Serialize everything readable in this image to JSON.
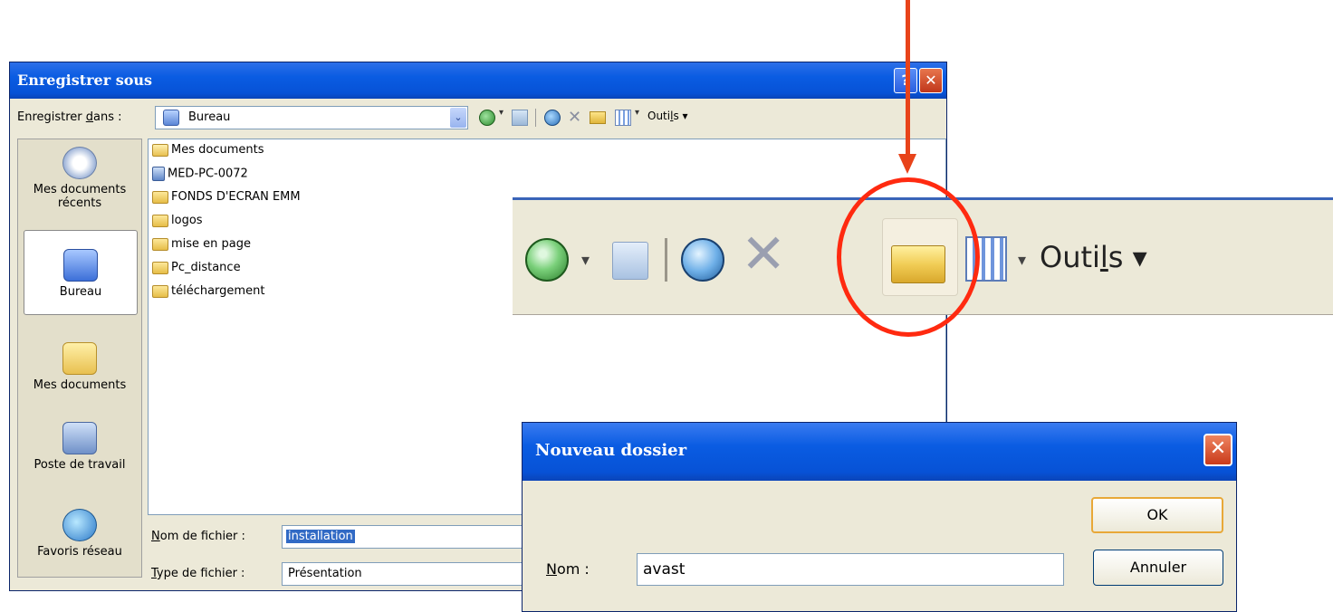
{
  "save_dialog": {
    "title": "Enregistrer sous",
    "help_label": "?",
    "close_label": "✕",
    "save_in": {
      "label_pre": "Enregistrer ",
      "label_u": "d",
      "label_post": "ans :",
      "value": "Bureau",
      "dropdown_glyph": "⌄"
    },
    "toolbar": {
      "tools_pre": "Outi",
      "tools_u": "l",
      "tools_post": "s",
      "dropdown_glyph": "▾"
    },
    "places": [
      {
        "label": "Mes documents récents",
        "icon": "recent-documents-icon"
      },
      {
        "label": "Bureau",
        "icon": "desktop-icon"
      },
      {
        "label": "Mes documents",
        "icon": "my-documents-icon"
      },
      {
        "label": "Poste de travail",
        "icon": "my-computer-icon"
      },
      {
        "label": "Favoris réseau",
        "icon": "network-places-icon"
      }
    ],
    "files": [
      {
        "name": "Mes documents",
        "icon": "my-documents-icon"
      },
      {
        "name": "MED-PC-0072",
        "icon": "computer-icon"
      },
      {
        "name": "FONDS D'ECRAN EMM",
        "icon": "folder-icon"
      },
      {
        "name": "logos",
        "icon": "folder-icon"
      },
      {
        "name": "mise en page",
        "icon": "folder-icon"
      },
      {
        "name": "Pc_distance",
        "icon": "folder-icon"
      },
      {
        "name": "téléchargement",
        "icon": "folder-icon"
      }
    ],
    "filename": {
      "label_u": "N",
      "label_post": "om de fichier :",
      "value": "installation"
    },
    "filetype": {
      "label_u": "T",
      "label_post": "ype de fichier :",
      "value": "Présentation"
    }
  },
  "zoom_toolbar": {
    "tools_pre": "Outi",
    "tools_u": "l",
    "tools_post": "s",
    "dropdown_glyph": "▾",
    "delete_glyph": "✕"
  },
  "annotation": {
    "color": "#e8431a"
  },
  "new_folder_dialog": {
    "title": "Nouveau dossier",
    "close_label": "✕",
    "ok_label": "OK",
    "cancel_label": "Annuler",
    "name_label_u": "N",
    "name_label_post": "om :",
    "name_value": "avast"
  }
}
